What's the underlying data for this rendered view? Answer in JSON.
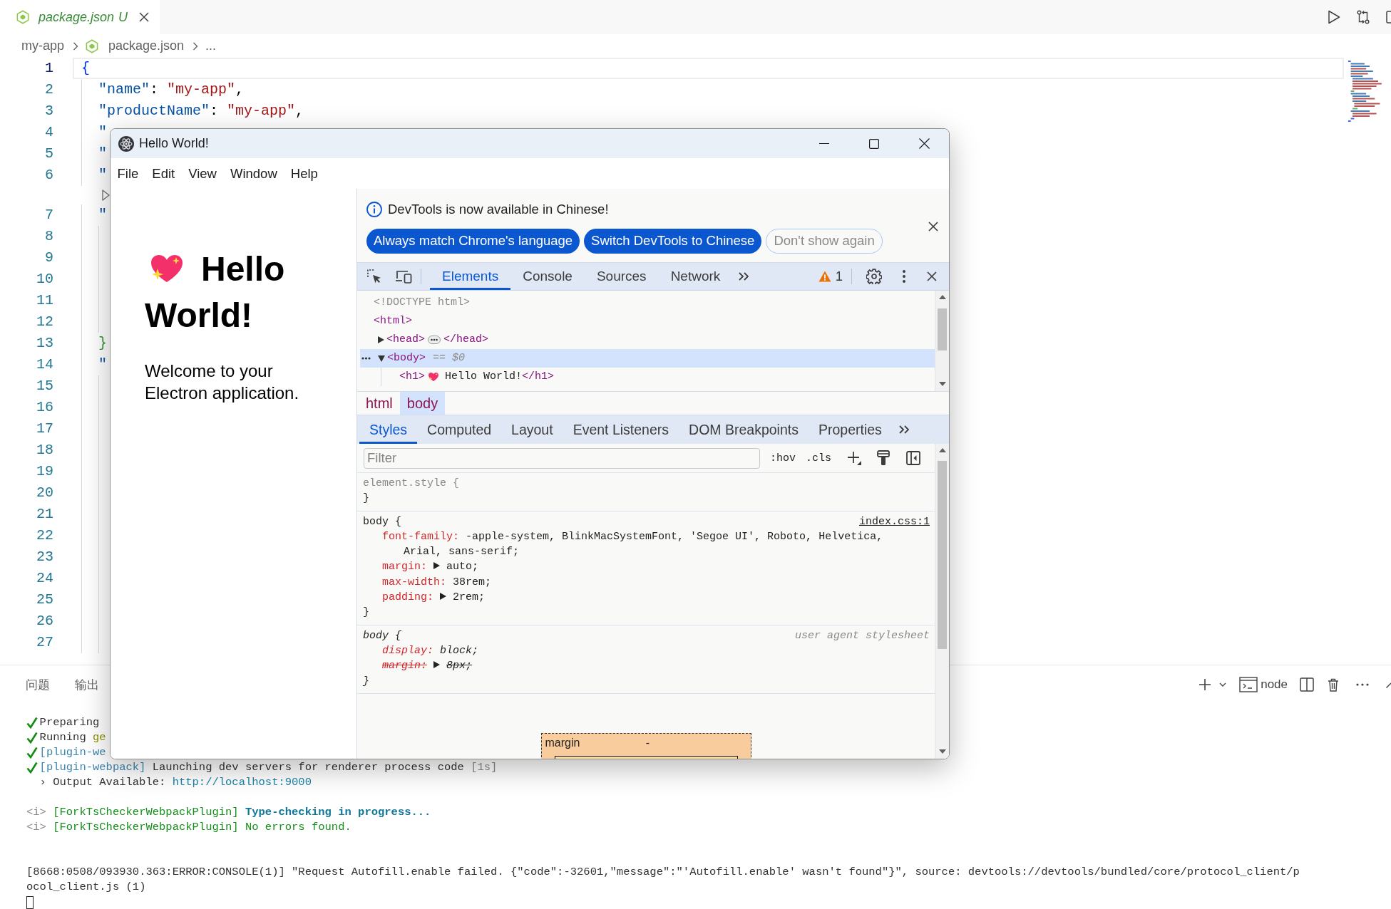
{
  "editor_tabs": [
    {
      "label": "package.json",
      "decoration": "U",
      "selected": true
    }
  ],
  "breadcrumb": [
    {
      "kind": "folder",
      "label": "my-app"
    },
    {
      "kind": "file",
      "label": "package.json"
    },
    {
      "kind": "more",
      "label": "..."
    }
  ],
  "editor": {
    "lines": [
      {
        "kind": "root",
        "number": "1",
        "current": true,
        "tokens": [
          {
            "kind": "bracket",
            "text": "{"
          }
        ]
      },
      {
        "kind": "member",
        "number": "2",
        "current": false,
        "tokens": [
          {
            "kind": "key",
            "text": "\"name\""
          },
          {
            "kind": "punct",
            "text": ": "
          },
          {
            "kind": "string",
            "text": "\"my-app\""
          },
          {
            "kind": "punct",
            "text": ","
          }
        ]
      },
      {
        "kind": "member",
        "number": "3",
        "current": false,
        "tokens": [
          {
            "kind": "key",
            "text": "\"productName\""
          },
          {
            "kind": "punct",
            "text": ": "
          },
          {
            "kind": "string",
            "text": "\"my-app\""
          },
          {
            "kind": "punct",
            "text": ","
          }
        ]
      },
      {
        "kind": "member",
        "number": "4",
        "current": false,
        "tokens": [
          {
            "kind": "key",
            "text": "\""
          }
        ]
      },
      {
        "kind": "member",
        "number": "5",
        "current": false,
        "tokens": [
          {
            "kind": "key",
            "text": "\""
          }
        ]
      },
      {
        "kind": "member",
        "number": "6",
        "current": false,
        "tokens": [
          {
            "kind": "key",
            "text": "\""
          }
        ]
      },
      {
        "kind": "codelens"
      },
      {
        "kind": "member",
        "number": "7",
        "current": false,
        "tokens": [
          {
            "kind": "key",
            "text": "\""
          }
        ]
      },
      {
        "kind": "blank",
        "number": "8",
        "current": false
      },
      {
        "kind": "blank",
        "number": "9",
        "current": false
      },
      {
        "kind": "blank",
        "number": "10",
        "current": false
      },
      {
        "kind": "blank",
        "number": "11",
        "current": false
      },
      {
        "kind": "blank",
        "number": "12",
        "current": false
      },
      {
        "kind": "member",
        "number": "13",
        "current": false,
        "tokens": [
          {
            "kind": "bracket2",
            "text": "}"
          }
        ]
      },
      {
        "kind": "member",
        "number": "14",
        "current": false,
        "tokens": [
          {
            "kind": "key",
            "text": "\""
          }
        ]
      },
      {
        "kind": "blank",
        "number": "15",
        "current": false
      },
      {
        "kind": "blank",
        "number": "16",
        "current": false
      },
      {
        "kind": "blank",
        "number": "17",
        "current": false
      },
      {
        "kind": "blank",
        "number": "18",
        "current": false
      },
      {
        "kind": "blank",
        "number": "19",
        "current": false
      },
      {
        "kind": "blank",
        "number": "20",
        "current": false
      },
      {
        "kind": "blank",
        "number": "21",
        "current": false
      },
      {
        "kind": "blank",
        "number": "22",
        "current": false
      },
      {
        "kind": "blank",
        "number": "23",
        "current": false
      },
      {
        "kind": "blank",
        "number": "24",
        "current": false
      },
      {
        "kind": "blank",
        "number": "25",
        "current": false
      },
      {
        "kind": "blank",
        "number": "26",
        "current": false
      },
      {
        "kind": "blank",
        "number": "27",
        "current": false
      }
    ]
  },
  "app_window": {
    "title": "Hello World!",
    "menu": [
      "File",
      "Edit",
      "View",
      "Window",
      "Help"
    ],
    "page": {
      "heading_lines": [
        "Hello",
        "World!"
      ],
      "paragraph": "Welcome to your Electron application."
    },
    "devtools": {
      "notice": {
        "message": "DevTools is now available in Chinese!",
        "buttons": [
          {
            "kind": "primary",
            "label": "Always match Chrome's language"
          },
          {
            "kind": "primary",
            "label": "Switch DevTools to Chinese"
          },
          {
            "kind": "secondary",
            "label": "Don't show again"
          }
        ]
      },
      "tabs": [
        {
          "label": "Elements",
          "selected": true
        },
        {
          "label": "Console",
          "selected": false
        },
        {
          "label": "Sources",
          "selected": false
        },
        {
          "label": "Network",
          "selected": false
        }
      ],
      "issues_count": "1",
      "dom_tree": [
        {
          "kind": "doctype",
          "text": "<!DOCTYPE html>",
          "selected": false
        },
        {
          "kind": "element",
          "open": "<html>",
          "selected": false,
          "children": [
            {
              "kind": "element",
              "open": "<head>",
              "close": "</head>",
              "expanded": false,
              "selected": false
            },
            {
              "kind": "element",
              "open": "<body>",
              "note": "== $0",
              "expanded": true,
              "selected": true,
              "children": [
                {
                  "kind": "inline",
                  "open": "<h1>",
                  "text": "Hello World!",
                  "close": "</h1>",
                  "selected": false
                }
              ]
            }
          ]
        }
      ],
      "breadcrumb": [
        {
          "label": "html",
          "selected": false
        },
        {
          "label": "body",
          "selected": true
        }
      ],
      "pane_tabs": [
        {
          "label": "Styles",
          "selected": true
        },
        {
          "label": "Computed",
          "selected": false
        },
        {
          "label": "Layout",
          "selected": false
        },
        {
          "label": "Event Listeners",
          "selected": false
        },
        {
          "label": "DOM Breakpoints",
          "selected": false
        },
        {
          "label": "Properties",
          "selected": false
        }
      ],
      "filter": {
        "placeholder": "Filter"
      },
      "toggles": [
        ":hov",
        ".cls"
      ],
      "rules": [
        {
          "kind": "inline",
          "selector": "element.style {",
          "close": "}"
        },
        {
          "kind": "author",
          "selector": "body {",
          "source": "index.css:1",
          "declarations": [
            {
              "property": "font-family:",
              "value": "-apple-system, BlinkMacSystemFont, 'Segoe UI', Roboto, Helvetica, Arial, sans-serif;",
              "expandable": false,
              "overridden": false
            },
            {
              "property": "margin:",
              "value": "auto;",
              "expandable": true,
              "overridden": false
            },
            {
              "property": "max-width:",
              "value": "38rem;",
              "expandable": false,
              "overridden": false
            },
            {
              "property": "padding:",
              "value": "2rem;",
              "expandable": true,
              "overridden": false
            }
          ],
          "close": "}"
        },
        {
          "kind": "user-agent",
          "selector": "body {",
          "source": "user agent stylesheet",
          "declarations": [
            {
              "property": "display:",
              "value": "block;",
              "expandable": false,
              "overridden": false
            },
            {
              "property": "margin:",
              "value": "8px;",
              "expandable": true,
              "overridden": true
            }
          ],
          "close": "}"
        }
      ],
      "box_model": {
        "label": "margin",
        "value": "-"
      }
    }
  },
  "panel": {
    "tabs": [
      {
        "label": "问题",
        "selected": false
      },
      {
        "label": "输出",
        "selected": false
      }
    ],
    "terminal_label": "node"
  },
  "terminal": {
    "blocks": [
      {
        "lines": [
          {
            "kind": "step",
            "segments": [
              {
                "kind": "plain",
                "text": "Preparing"
              }
            ]
          },
          {
            "kind": "step",
            "segments": [
              {
                "kind": "plain",
                "text": "Running "
              },
              {
                "kind": "highlight",
                "text": "ge"
              }
            ]
          },
          {
            "kind": "step",
            "segments": [
              {
                "kind": "tag",
                "text": "[plugin-we"
              }
            ]
          },
          {
            "kind": "step",
            "segments": [
              {
                "kind": "tag",
                "text": "[plugin-webpack]"
              },
              {
                "kind": "plain",
                "text": " Launching dev servers for renderer process code "
              },
              {
                "kind": "dim",
                "text": "[1s]"
              }
            ]
          },
          {
            "kind": "detail",
            "segments": [
              {
                "kind": "plain",
                "text": "› Output Available: "
              },
              {
                "kind": "link",
                "text": "http://localhost:9000"
              }
            ]
          }
        ]
      },
      {
        "lines": [
          {
            "kind": "log",
            "segments": [
              {
                "kind": "dim",
                "text": "<i>"
              },
              {
                "kind": "success",
                "text": " [ForkTsCheckerWebpackPlugin]"
              },
              {
                "kind": "info",
                "text": " Type-checking in progress..."
              }
            ]
          },
          {
            "kind": "log",
            "segments": [
              {
                "kind": "dim",
                "text": "<i>"
              },
              {
                "kind": "success",
                "text": " [ForkTsCheckerWebpackPlugin] No errors found."
              }
            ]
          }
        ]
      },
      {
        "lines": [
          {
            "kind": "log",
            "segments": [
              {
                "kind": "plain",
                "text": "[8668:0508/093930.363:ERROR:CONSOLE(1)] \"Request Autofill.enable failed. {\"code\":-32601,\"message\":\"'Autofill.enable' wasn't found\"}\", source: devtools://devtools/bundled/core/protocol_client/p"
              }
            ]
          },
          {
            "kind": "log",
            "segments": [
              {
                "kind": "plain",
                "text": "ocol_client.js (1)"
              }
            ]
          }
        ]
      }
    ]
  }
}
